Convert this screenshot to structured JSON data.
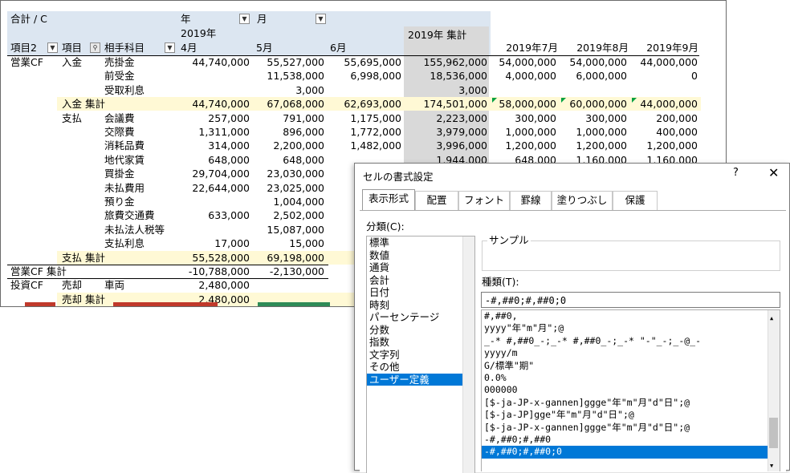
{
  "sheet": {
    "header": {
      "label": "合計 / C",
      "year_field": "年",
      "month_field": "月",
      "year_2019": "2019年",
      "row2": "項目2",
      "row1": "項目",
      "account": "相手科目",
      "apr": "4月",
      "may": "5月",
      "jun": "6月",
      "total_2019": "2019年 集計",
      "jul": "2019年7月",
      "aug": "2019年8月",
      "sep": "2019年9月"
    },
    "cols": {
      "apr": "4月",
      "may": "5月",
      "jun": "6月"
    },
    "rows": [
      {
        "g2": "営業CF",
        "g1": "入金",
        "acct": "売掛金",
        "v": [
          "44,740,000",
          "55,527,000",
          "55,695,000",
          "155,962,000",
          "54,000,000",
          "54,000,000",
          "44,000,000"
        ]
      },
      {
        "g2": "",
        "g1": "",
        "acct": "前受金",
        "v": [
          "",
          "11,538,000",
          "6,998,000",
          "18,536,000",
          "4,000,000",
          "6,000,000",
          "0"
        ]
      },
      {
        "g2": "",
        "g1": "",
        "acct": "受取利息",
        "v": [
          "",
          "3,000",
          "",
          "3,000",
          "",
          "",
          ""
        ]
      },
      {
        "g2": "",
        "g1": "入金 集計",
        "acct": "",
        "sub": true,
        "v": [
          "44,740,000",
          "67,068,000",
          "62,693,000",
          "174,501,000",
          "58,000,000",
          "60,000,000",
          "44,000,000"
        ]
      },
      {
        "g2": "",
        "g1": "支払",
        "acct": "会議費",
        "v": [
          "257,000",
          "791,000",
          "1,175,000",
          "2,223,000",
          "300,000",
          "300,000",
          "200,000"
        ]
      },
      {
        "g2": "",
        "g1": "",
        "acct": "交際費",
        "v": [
          "1,311,000",
          "896,000",
          "1,772,000",
          "3,979,000",
          "1,000,000",
          "1,000,000",
          "400,000"
        ]
      },
      {
        "g2": "",
        "g1": "",
        "acct": "消耗品費",
        "v": [
          "314,000",
          "2,200,000",
          "1,482,000",
          "3,996,000",
          "1,200,000",
          "1,200,000",
          "1,200,000"
        ]
      },
      {
        "g2": "",
        "g1": "",
        "acct": "地代家賃",
        "v": [
          "648,000",
          "648,000",
          "",
          "1,944,000",
          "648,000",
          "1,160,000",
          "1,160,000"
        ]
      },
      {
        "g2": "",
        "g1": "",
        "acct": "買掛金",
        "v": [
          "29,704,000",
          "23,030,000",
          "",
          "",
          "",
          "",
          ""
        ]
      },
      {
        "g2": "",
        "g1": "",
        "acct": "未払費用",
        "v": [
          "22,644,000",
          "23,025,000",
          "",
          "",
          "",
          "",
          ""
        ]
      },
      {
        "g2": "",
        "g1": "",
        "acct": "預り金",
        "v": [
          "",
          "1,004,000",
          "",
          "",
          "",
          "",
          ""
        ]
      },
      {
        "g2": "",
        "g1": "",
        "acct": "旅費交通費",
        "v": [
          "633,000",
          "2,502,000",
          "",
          "",
          "",
          "",
          ""
        ]
      },
      {
        "g2": "",
        "g1": "",
        "acct": "未払法人税等",
        "v": [
          "",
          "15,087,000",
          "",
          "",
          "",
          "",
          ""
        ]
      },
      {
        "g2": "",
        "g1": "",
        "acct": "支払利息",
        "v": [
          "17,000",
          "15,000",
          "",
          "",
          "",
          "",
          ""
        ]
      },
      {
        "g2": "",
        "g1": "支払 集計",
        "acct": "",
        "sub": true,
        "v": [
          "55,528,000",
          "69,198,000",
          "6",
          "",
          "",
          "",
          ""
        ]
      },
      {
        "g2": "営業CF 集計",
        "g1": "",
        "acct": "",
        "v": [
          "-10,788,000",
          "-2,130,000",
          "",
          "",
          "",
          "",
          ""
        ]
      },
      {
        "g2": "投資CF",
        "g1": "売却",
        "acct": "車両",
        "v": [
          "2,480,000",
          "",
          "",
          "",
          "",
          "",
          ""
        ]
      },
      {
        "g2": "",
        "g1": "売却 集計",
        "acct": "",
        "sub": true,
        "v": [
          "2,480,000",
          "",
          "",
          "",
          "",
          "",
          ""
        ]
      }
    ]
  },
  "dialog": {
    "title": "セルの書式設定",
    "help": "?",
    "close": "✕",
    "tabs": [
      "表示形式",
      "配置",
      "フォント",
      "罫線",
      "塗りつぶし",
      "保護"
    ],
    "category_label": "分類(C):",
    "categories": [
      "標準",
      "数値",
      "通貨",
      "会計",
      "日付",
      "時刻",
      "パーセンテージ",
      "分数",
      "指数",
      "文字列",
      "その他",
      "ユーザー定義"
    ],
    "selected_category": 11,
    "sample_label": "サンプル",
    "type_label": "種類(T):",
    "type_value": "-#,##0;#,##0;0",
    "formats": [
      "#,##0,",
      "yyyy\"年\"m\"月\";@",
      "_-* #,##0_-;_-* #,##0_-;_-* \"-\"_-;_-@_-",
      "yyyy/m",
      "G/標準\"期\"",
      "0.0%",
      "000000",
      "[$-ja-JP-x-gannen]ggge\"年\"m\"月\"d\"日\";@",
      "[$-ja-JP]gge\"年\"m\"月\"d\"日\";@",
      "[$-ja-JP-x-gannen]ggge\"年\"m\"月\"d\"日\";@",
      "-#,##0;#,##0",
      "-#,##0;#,##0;0"
    ],
    "selected_format": 11
  }
}
